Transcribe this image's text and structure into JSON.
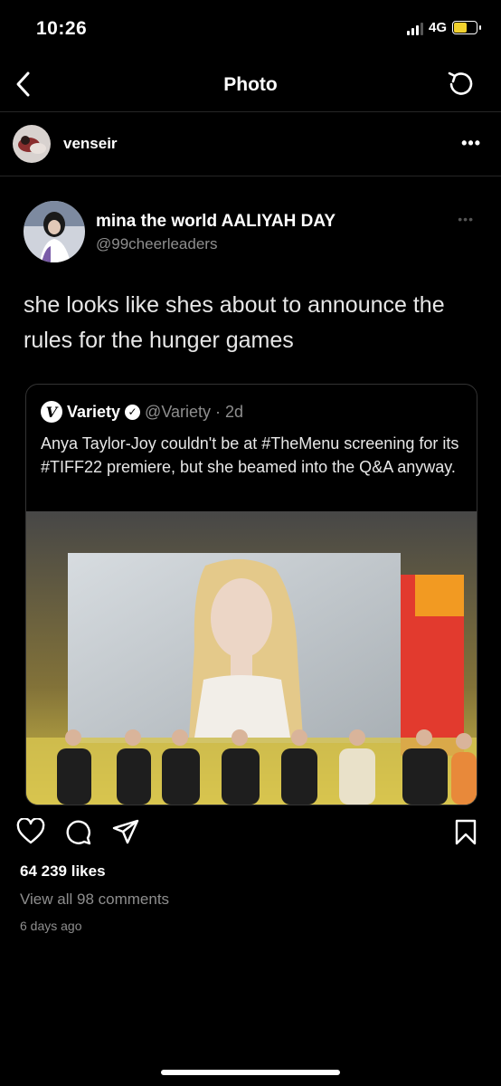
{
  "status_bar": {
    "time": "10:26",
    "network": "4G"
  },
  "header": {
    "title": "Photo",
    "back_icon": "chevron-left-icon",
    "refresh_icon": "refresh-icon"
  },
  "post": {
    "username": "venseir",
    "more_label": "•••",
    "likes": "64 239 likes",
    "comments_link": "View all 98 comments",
    "posted": "6 days ago"
  },
  "tweet": {
    "name": "mina the world AALIYAH DAY",
    "handle": "@99cheerleaders",
    "more_label": "•••",
    "text": "she looks like shes about to announce the rules for the hunger games",
    "quote": {
      "logo": "V",
      "name": "Variety",
      "handle_time": "@Variety · 2d",
      "text": "Anya Taylor-Joy couldn't be at #TheMenu screening for its #TIFF22 premiere, but she beamed into the Q&A anyway."
    }
  },
  "colors": {
    "background": "#000000",
    "muted": "#8e8e8e",
    "divider": "#262626",
    "battery": "#f2d22e"
  }
}
